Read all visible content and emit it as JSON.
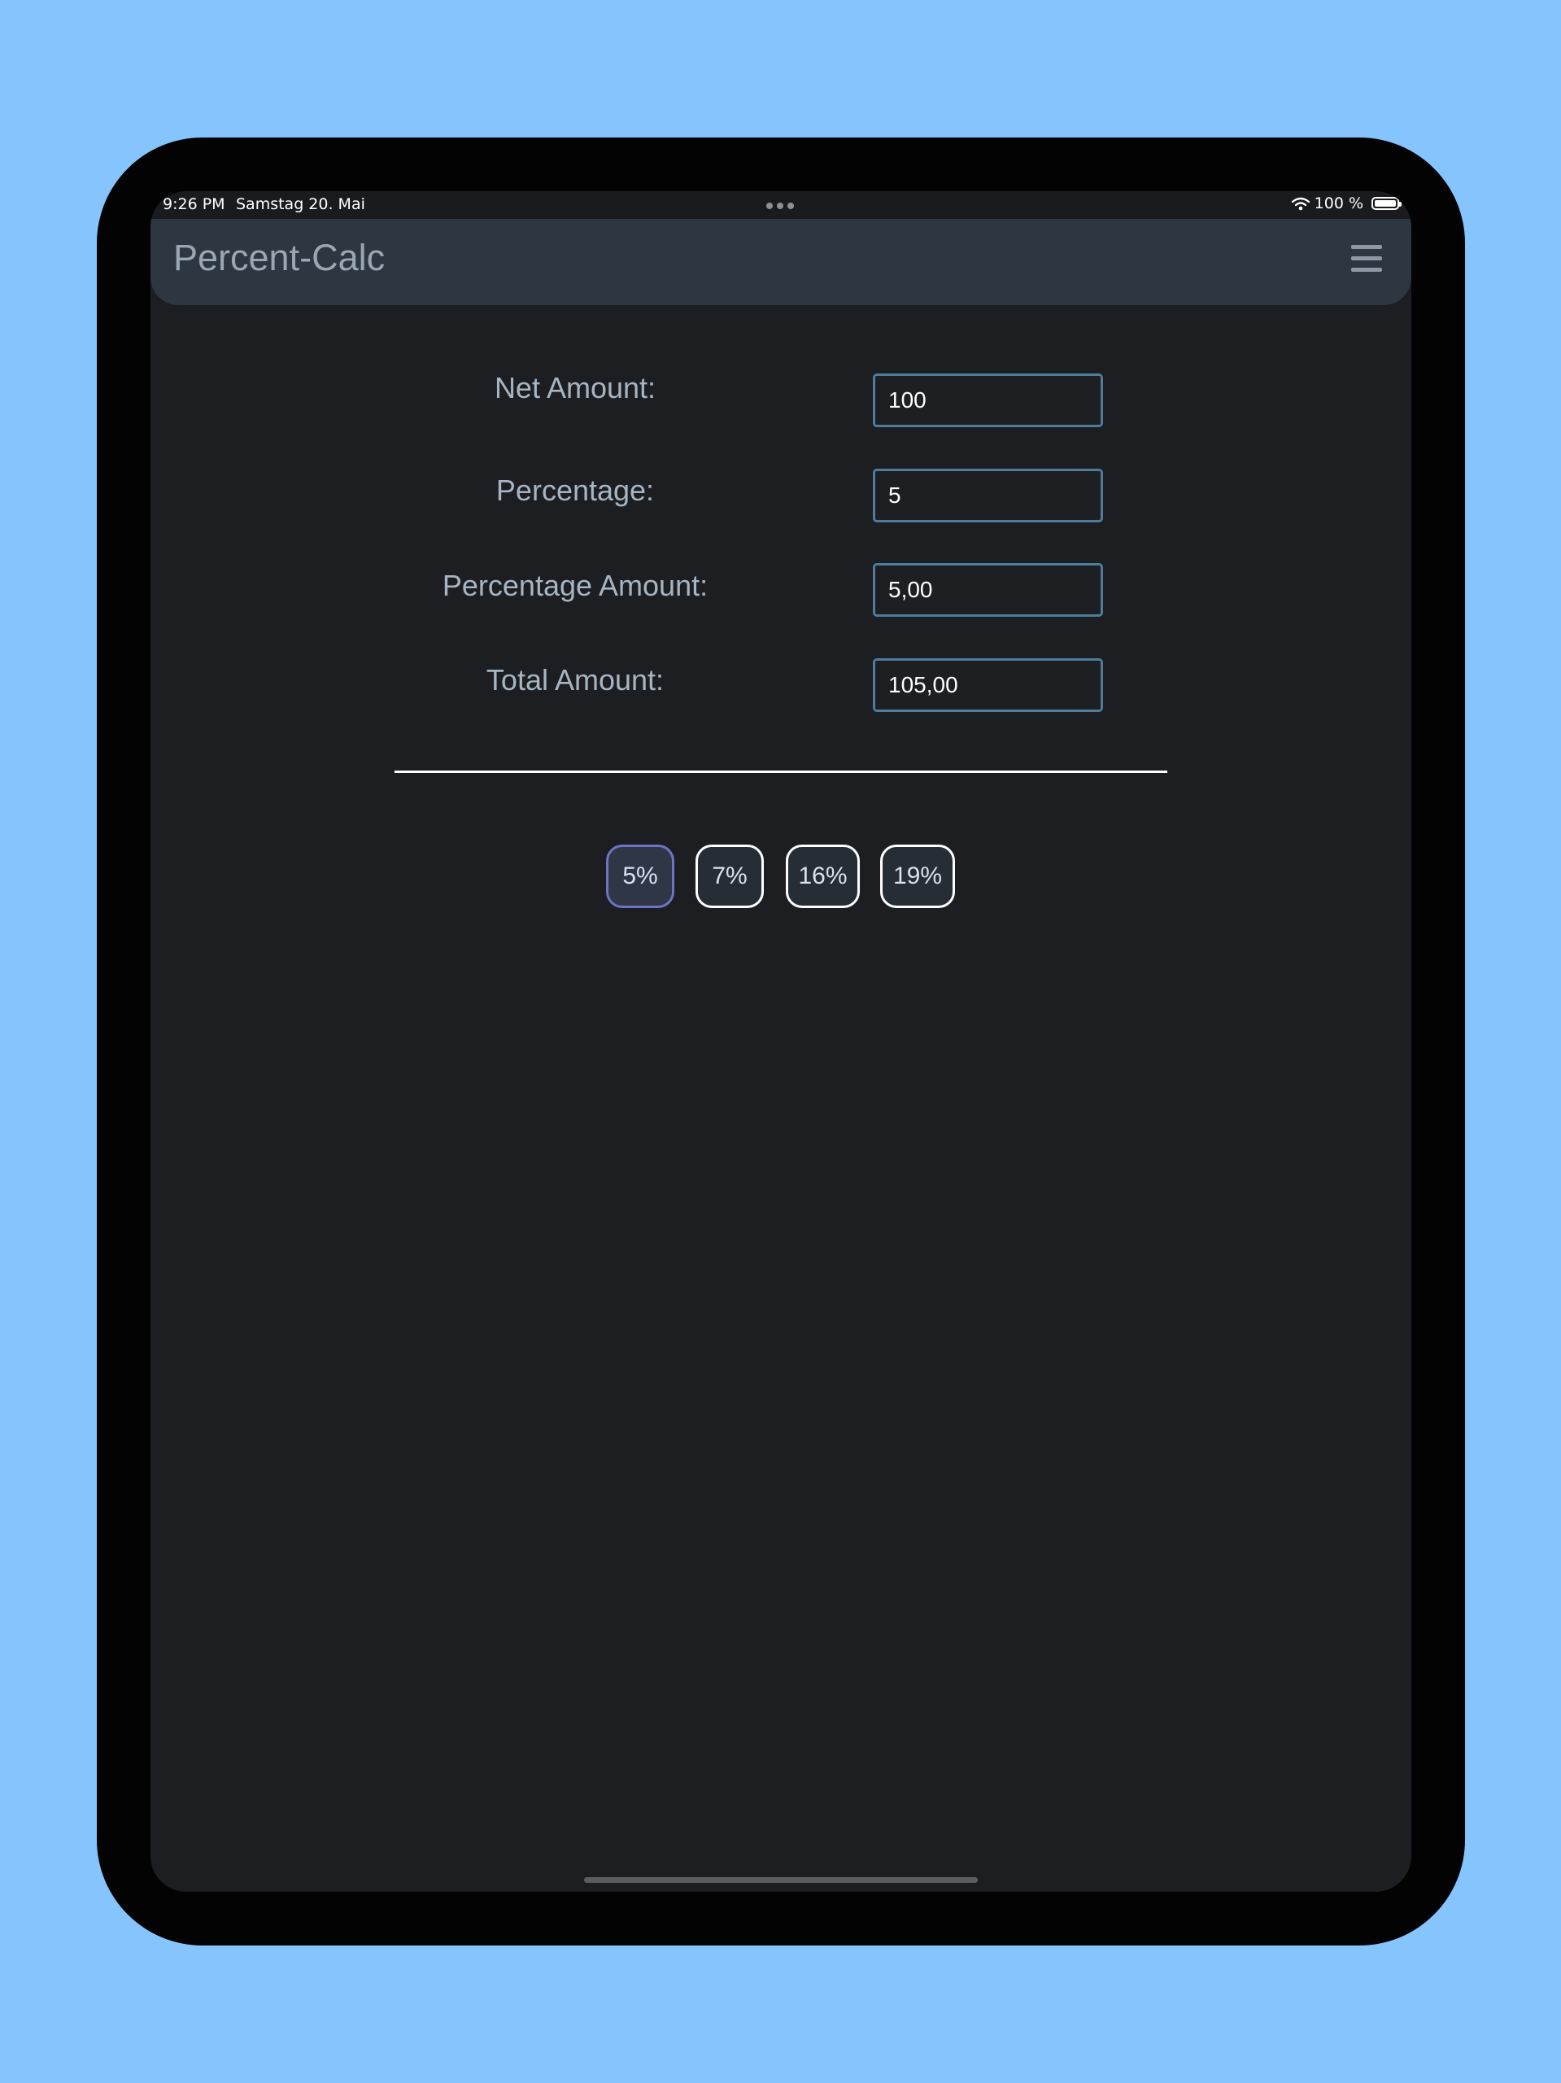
{
  "status_bar": {
    "time": "9:26 PM",
    "date": "Samstag 20. Mai",
    "battery_text": "100 %",
    "wifi_icon": "wifi-icon",
    "battery_icon": "battery-icon"
  },
  "header": {
    "title": "Percent-Calc",
    "menu_icon": "hamburger-menu-icon"
  },
  "form": {
    "net_amount": {
      "label": "Net Amount:",
      "value": "100"
    },
    "percentage": {
      "label": "Percentage:",
      "value": "5"
    },
    "percentage_amount": {
      "label": "Percentage Amount:",
      "value": "5,00"
    },
    "total_amount": {
      "label": "Total Amount:",
      "value": "105,00"
    }
  },
  "presets": [
    {
      "label": "5%",
      "selected": true
    },
    {
      "label": "7%",
      "selected": false
    },
    {
      "label": "16%",
      "selected": false
    },
    {
      "label": "19%",
      "selected": false
    }
  ],
  "colors": {
    "page_background": "#86c4fd",
    "screen_background": "#1d1e22",
    "navbar_background": "#2c3741",
    "input_border": "#4e7c9b",
    "selected_chip_border": "#6d74c4"
  }
}
